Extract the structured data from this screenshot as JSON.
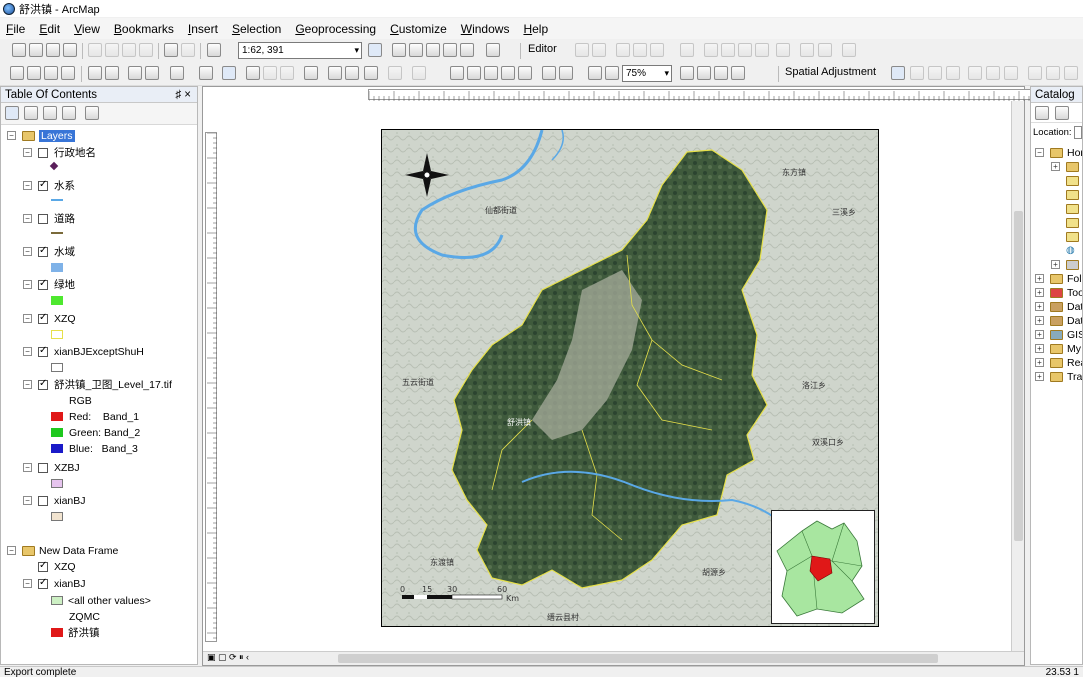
{
  "window": {
    "title": "舒洪镇 - ArcMap"
  },
  "menu": [
    "File",
    "Edit",
    "View",
    "Bookmarks",
    "Insert",
    "Selection",
    "Geoprocessing",
    "Customize",
    "Windows",
    "Help"
  ],
  "toolbar": {
    "scale": "1:62, 391",
    "editor_label": "Editor",
    "zoom": "75%",
    "spatial_adjustment": "Spatial Adjustment"
  },
  "toc": {
    "title": "Table Of Contents",
    "pin": "♯ ×",
    "frame1": "Layers",
    "layers": [
      {
        "name": "行政地名",
        "checked": false
      },
      {
        "name": "水系",
        "checked": true
      },
      {
        "name": "道路",
        "checked": false
      },
      {
        "name": "水域",
        "checked": true
      },
      {
        "name": "绿地",
        "checked": true
      },
      {
        "name": "XZQ",
        "checked": true
      },
      {
        "name": "xianBJExceptShuH",
        "checked": true
      },
      {
        "name": "舒洪镇_卫图_Level_17.tif",
        "checked": true
      },
      {
        "name": "XZBJ",
        "checked": false
      },
      {
        "name": "xianBJ",
        "checked": false
      }
    ],
    "raster": {
      "rgb": "RGB",
      "red": "Red:    Band_1",
      "green": "Green: Band_2",
      "blue": "Blue:   Band_3"
    },
    "frame2": "New Data Frame",
    "layers2": [
      {
        "name": "XZQ",
        "checked": true
      },
      {
        "name": "xianBJ",
        "checked": true
      }
    ],
    "other_values": "<all other values>",
    "field": "ZQMC",
    "value": "舒洪镇"
  },
  "catalog": {
    "title": "Catalog",
    "location": "Location:",
    "items": [
      "Hor",
      "Fol",
      "Too",
      "Dat",
      "Dat",
      "GIS",
      "My",
      "Rea",
      "Tra"
    ]
  },
  "map": {
    "labels": [
      "仙都街道",
      "东方镇",
      "三溪乡",
      "五云街道",
      "洛江乡",
      "双溪口乡",
      "舒洪镇",
      "东渡镇",
      "胡源乡",
      "缙云县村"
    ],
    "scale_ticks": [
      "0",
      "15",
      "30",
      "60"
    ],
    "scale_unit": "Km"
  },
  "status": {
    "left": "Export complete",
    "right": "23.53  1"
  },
  "colors": {
    "selection": "#3875d7",
    "boundary": "#e6e04a",
    "river": "#5aa8e6",
    "highlight": "#e01818",
    "region": "#a8e6a0"
  }
}
